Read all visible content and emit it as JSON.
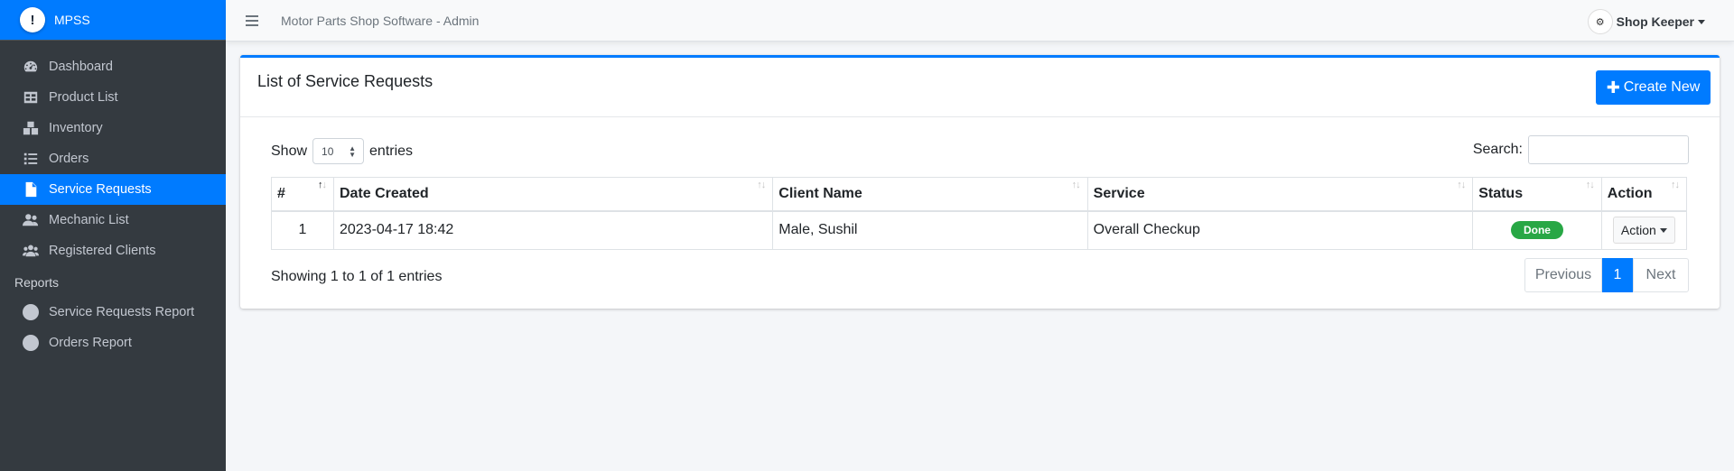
{
  "brand": {
    "name": "MPSS",
    "logo_glyph": "!"
  },
  "topbar": {
    "app_title": "Motor Parts Shop Software - Admin",
    "user_name": "Shop Keeper"
  },
  "sidebar": {
    "items": [
      {
        "label": "Dashboard",
        "icon": "tachometer-icon"
      },
      {
        "label": "Product List",
        "icon": "table-icon"
      },
      {
        "label": "Inventory",
        "icon": "boxes-icon"
      },
      {
        "label": "Orders",
        "icon": "list-icon"
      },
      {
        "label": "Service Requests",
        "icon": "file-icon",
        "active": true
      },
      {
        "label": "Mechanic List",
        "icon": "users-icon"
      },
      {
        "label": "Registered Clients",
        "icon": "users-group-icon"
      }
    ],
    "reports_header": "Reports",
    "reports": [
      {
        "label": "Service Requests Report",
        "icon": "circle-icon"
      },
      {
        "label": "Orders Report",
        "icon": "circle-icon"
      }
    ]
  },
  "card": {
    "title": "List of Service Requests",
    "create_button": "Create New",
    "show_label": "Show",
    "entries_value": "10",
    "entries_label": "entries",
    "search_label": "Search:",
    "columns": [
      "#",
      "Date Created",
      "Client Name",
      "Service",
      "Status",
      "Action"
    ],
    "rows": [
      {
        "num": "1",
        "date": "2023-04-17 18:42",
        "client": "Male, Sushil",
        "service": "Overall Checkup",
        "status": "Done",
        "action": "Action"
      }
    ],
    "info": "Showing 1 to 1 of 1 entries",
    "pagination": {
      "previous": "Previous",
      "page": "1",
      "next": "Next"
    }
  },
  "colors": {
    "primary": "#007bff",
    "sidebar_bg": "#343a40",
    "success": "#28a745"
  }
}
